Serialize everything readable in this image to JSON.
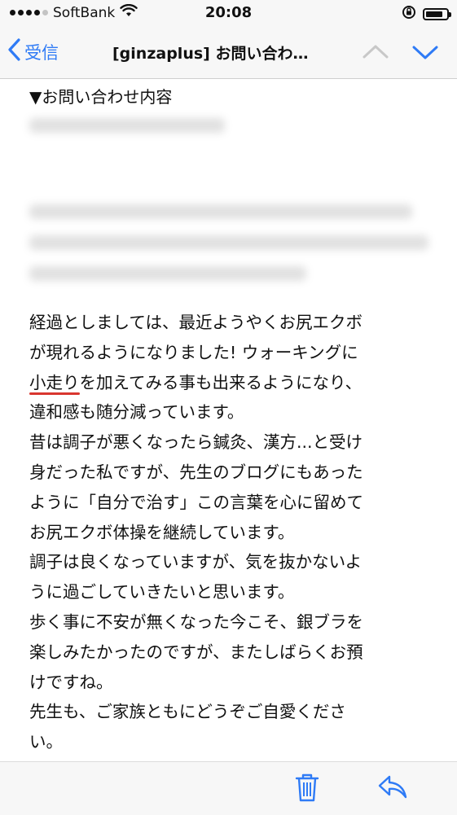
{
  "status_bar": {
    "carrier": "SoftBank",
    "time": "20:08",
    "battery_level": 0.85
  },
  "nav": {
    "back_label": "受信",
    "title": "[ginzaplus] お問い合わ…"
  },
  "message": {
    "section_heading": "▼お問い合わせ内容",
    "lines": [
      {
        "parts": [
          "経過としましては、最近ようやくお尻エクボ"
        ]
      },
      {
        "parts": [
          "が現れるようになりました! ウォーキングに"
        ]
      },
      {
        "parts": [
          "小走り",
          "を加えてみる事も出来るようになり、"
        ]
      },
      {
        "parts": [
          "違和感も随分減っています。"
        ]
      },
      {
        "parts": [
          "昔は調子が悪くなったら鍼灸、漢方...と受け"
        ]
      },
      {
        "parts": [
          "身だった私ですが、先生のブログにもあった"
        ]
      },
      {
        "parts": [
          "ように「自分で治す」この言葉を心に留めて"
        ]
      },
      {
        "parts": [
          "お尻エクボ体操を継続しています。"
        ]
      },
      {
        "parts": [
          "調子は良くなっていますが、気を抜かないよ"
        ]
      },
      {
        "parts": [
          "うに過ごしていきたいと思います。"
        ]
      },
      {
        "parts": [
          "歩く事に不安が無くなった今こそ、銀ブラを"
        ]
      },
      {
        "parts": [
          "楽しみたかったのですが、またしばらくお預"
        ]
      },
      {
        "parts": [
          "けですね。"
        ]
      },
      {
        "parts": [
          "先生も、ご家族ともにどうぞご自愛くださ"
        ]
      },
      {
        "parts": [
          "い。"
        ]
      }
    ]
  },
  "colors": {
    "accent": "#2f7bf6",
    "underline": "#d9362f",
    "bar_background": "#f7f7f7"
  },
  "icons": {
    "back": "chevron-left-icon",
    "prev": "chevron-up-icon",
    "next": "chevron-down-icon",
    "trash": "trash-icon",
    "reply": "reply-icon"
  }
}
